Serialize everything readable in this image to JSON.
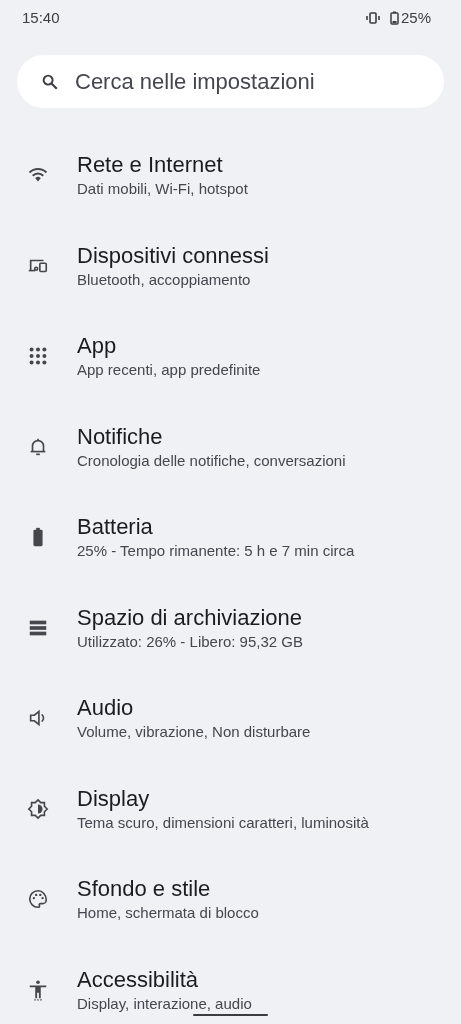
{
  "status_bar": {
    "time": "15:40",
    "battery": "25%"
  },
  "search": {
    "placeholder": "Cerca nelle impostazioni"
  },
  "items": [
    {
      "title": "Rete e Internet",
      "subtitle": "Dati mobili, Wi-Fi, hotspot"
    },
    {
      "title": "Dispositivi connessi",
      "subtitle": "Bluetooth, accoppiamento"
    },
    {
      "title": "App",
      "subtitle": "App recenti, app predefinite"
    },
    {
      "title": "Notifiche",
      "subtitle": "Cronologia delle notifiche, conversazioni"
    },
    {
      "title": "Batteria",
      "subtitle": "25% - Tempo rimanente: 5 h e 7 min circa"
    },
    {
      "title": "Spazio di archiviazione",
      "subtitle": "Utilizzato: 26% - Libero: 95,32 GB"
    },
    {
      "title": "Audio",
      "subtitle": "Volume, vibrazione, Non disturbare"
    },
    {
      "title": "Display",
      "subtitle": "Tema scuro, dimensioni caratteri, luminosità"
    },
    {
      "title": "Sfondo e stile",
      "subtitle": "Home, schermata di blocco"
    },
    {
      "title": "Accessibilità",
      "subtitle": "Display, interazione, audio"
    }
  ]
}
